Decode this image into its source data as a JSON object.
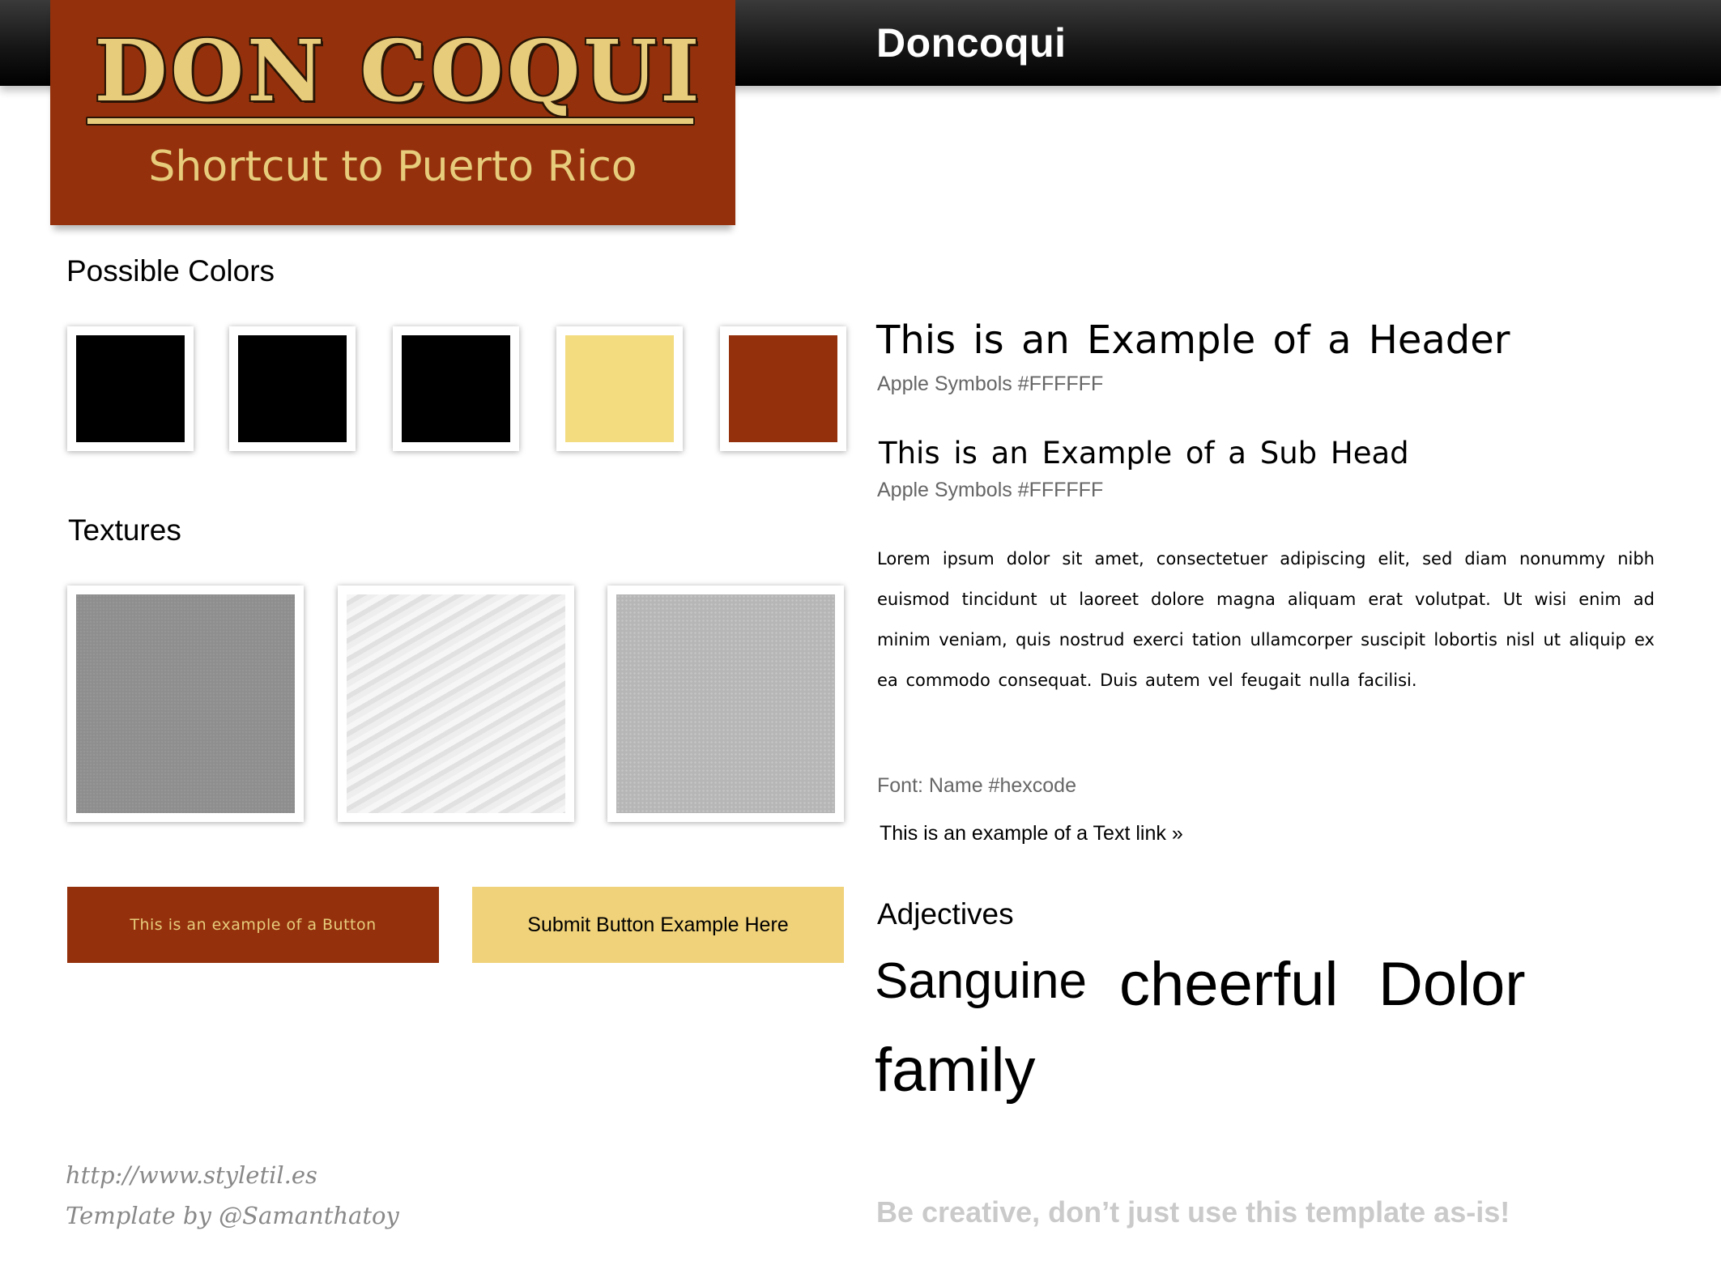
{
  "header": {
    "title": "Doncoqui"
  },
  "logo": {
    "name": "Don Coqui",
    "tagline": "Shortcut to Puerto Rico"
  },
  "colors": {
    "label": "Possible Colors",
    "swatches": [
      "#000000",
      "#000000",
      "#000000",
      "#f3dc80",
      "#94310c"
    ]
  },
  "textures": {
    "label": "Textures",
    "items": [
      "gray-noise-texture",
      "light-wave-texture",
      "light-gray-grain-texture"
    ]
  },
  "buttons": {
    "primary_label": "This is an example of a Button",
    "submit_label": "Submit Button Example Here"
  },
  "credits": {
    "url": "http://www.styletil.es",
    "template_by": "Template by @Samanthatoy"
  },
  "typography": {
    "header_example": "This is an Example of a Header",
    "header_font": "Apple Symbols #FFFFFF",
    "subhead_example": "This is an Example of a Sub Head",
    "subhead_font": "Apple Symbols #FFFFFF",
    "body_text": "Lorem ipsum dolor sit amet, consectetuer adipiscing elit, sed diam nonummy nibh euismod tincidunt ut laoreet dolore magna aliquam erat volutpat. Ut wisi enim ad minim veniam, quis nostrud exerci tation ullamcorper suscipit lobortis nisl ut aliquip ex ea commodo consequat. Duis autem vel feugait nulla facilisi.",
    "font_note": "Font: Name #hexcode",
    "text_link": "This is an example of a Text link »"
  },
  "adjectives": {
    "label": "Adjectives",
    "words": [
      "Sanguine",
      "cheerful",
      "Dolor",
      "family"
    ]
  },
  "footer_note": "Be creative, don’t just use this template as-is!"
}
